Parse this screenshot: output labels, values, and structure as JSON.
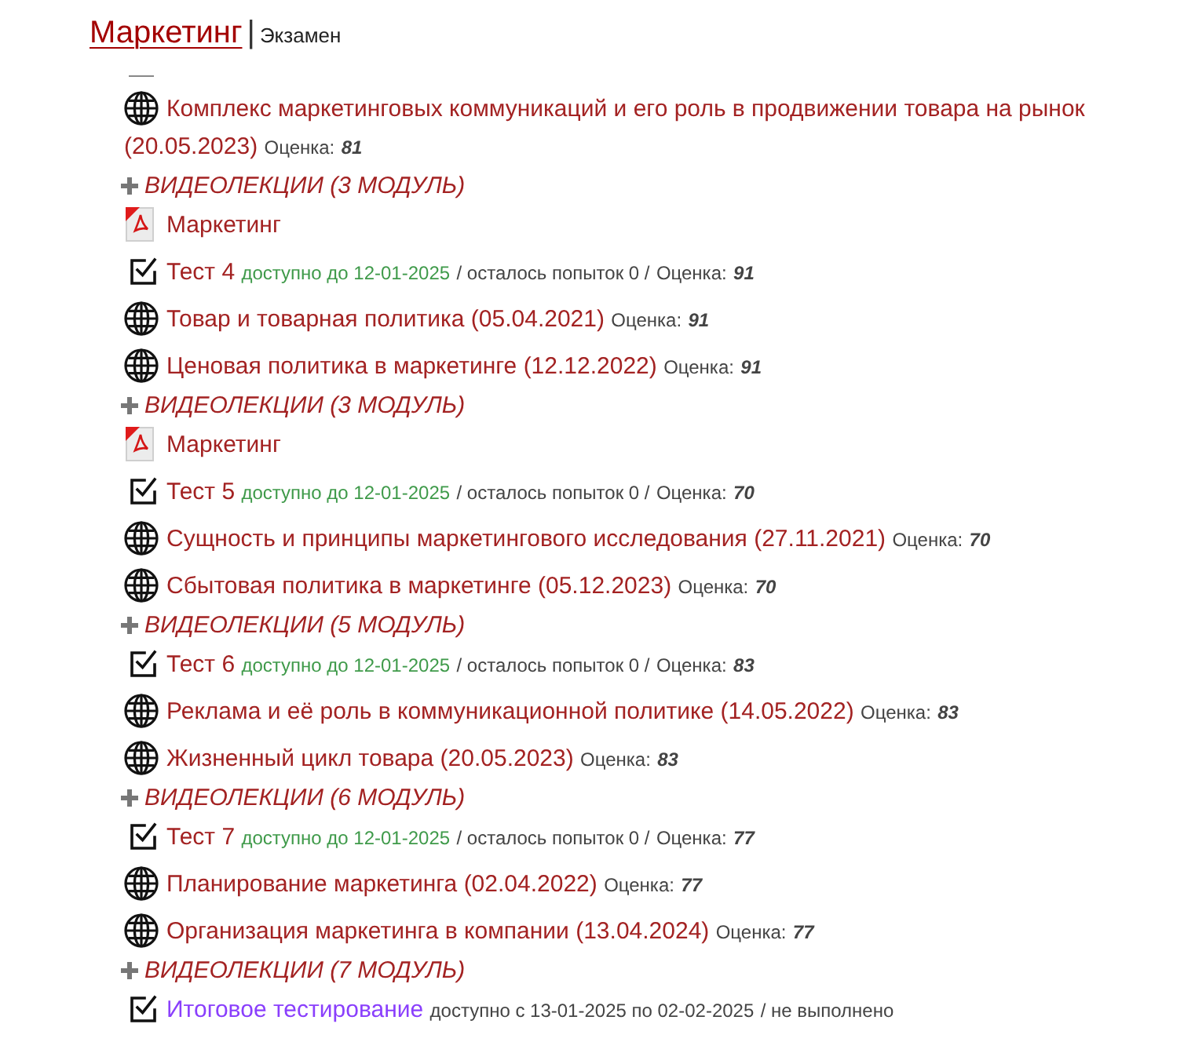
{
  "header": {
    "title": "Маркетинг",
    "separator": "|",
    "subtitle": "Экзамен"
  },
  "items": [
    {
      "kind": "lecture",
      "title": "Комплекс маркетинговых коммуникаций и его роль в продвижении товара на рынок",
      "date": "(20.05.2023)",
      "grade_label": "Оценка:",
      "grade": "81"
    },
    {
      "kind": "group",
      "title": "ВИДЕОЛЕКЦИИ (3 МОДУЛЬ)",
      "expanded": false
    },
    {
      "kind": "pdf",
      "title": "Маркетинг"
    },
    {
      "kind": "test",
      "title": "Тест 4",
      "availability": "доступно до 12-01-2025",
      "status": "/ осталось попыток 0 /",
      "grade_label": "Оценка:",
      "grade": "91"
    },
    {
      "kind": "lecture",
      "title": "Товар и товарная политика",
      "date": "(05.04.2021)",
      "grade_label": "Оценка:",
      "grade": "91"
    },
    {
      "kind": "lecture",
      "title": "Ценовая политика в маркетинге",
      "date": "(12.12.2022)",
      "grade_label": "Оценка:",
      "grade": "91"
    },
    {
      "kind": "group",
      "title": "ВИДЕОЛЕКЦИИ (3 МОДУЛЬ)",
      "expanded": false
    },
    {
      "kind": "pdf",
      "title": "Маркетинг"
    },
    {
      "kind": "test",
      "title": "Тест 5",
      "availability": "доступно до 12-01-2025",
      "status": "/ осталось попыток 0 /",
      "grade_label": "Оценка:",
      "grade": "70"
    },
    {
      "kind": "lecture",
      "title": "Сущность и принципы маркетингового исследования",
      "date": "(27.11.2021)",
      "grade_label": "Оценка:",
      "grade": "70"
    },
    {
      "kind": "lecture",
      "title": "Сбытовая политика в маркетинге",
      "date": "(05.12.2023)",
      "grade_label": "Оценка:",
      "grade": "70"
    },
    {
      "kind": "group",
      "title": "ВИДЕОЛЕКЦИИ (5 МОДУЛЬ)",
      "expanded": false
    },
    {
      "kind": "test",
      "title": "Тест 6",
      "availability": "доступно до 12-01-2025",
      "status": "/ осталось попыток 0 /",
      "grade_label": "Оценка:",
      "grade": "83"
    },
    {
      "kind": "lecture",
      "title": "Реклама и её роль в коммуникационной политике",
      "date": "(14.05.2022)",
      "grade_label": "Оценка:",
      "grade": "83"
    },
    {
      "kind": "lecture",
      "title": "Жизненный цикл товара",
      "date": "(20.05.2023)",
      "grade_label": "Оценка:",
      "grade": "83"
    },
    {
      "kind": "group",
      "title": "ВИДЕОЛЕКЦИИ (6 МОДУЛЬ)",
      "expanded": false
    },
    {
      "kind": "test",
      "title": "Тест 7",
      "availability": "доступно до 12-01-2025",
      "status": "/ осталось попыток 0 /",
      "grade_label": "Оценка:",
      "grade": "77"
    },
    {
      "kind": "lecture",
      "title": "Планирование маркетинга",
      "date": "(02.04.2022)",
      "grade_label": "Оценка:",
      "grade": "77"
    },
    {
      "kind": "lecture",
      "title": "Организация маркетинга в компании",
      "date": "(13.04.2024)",
      "grade_label": "Оценка:",
      "grade": "77"
    },
    {
      "kind": "group",
      "title": "ВИДЕОЛЕКЦИИ (7 МОДУЛЬ)",
      "expanded": false
    },
    {
      "kind": "final_test",
      "title": "Итоговое тестирование",
      "availability": "доступно с 13-01-2025 по 02-02-2025",
      "status": "/ не выполнено"
    }
  ]
}
